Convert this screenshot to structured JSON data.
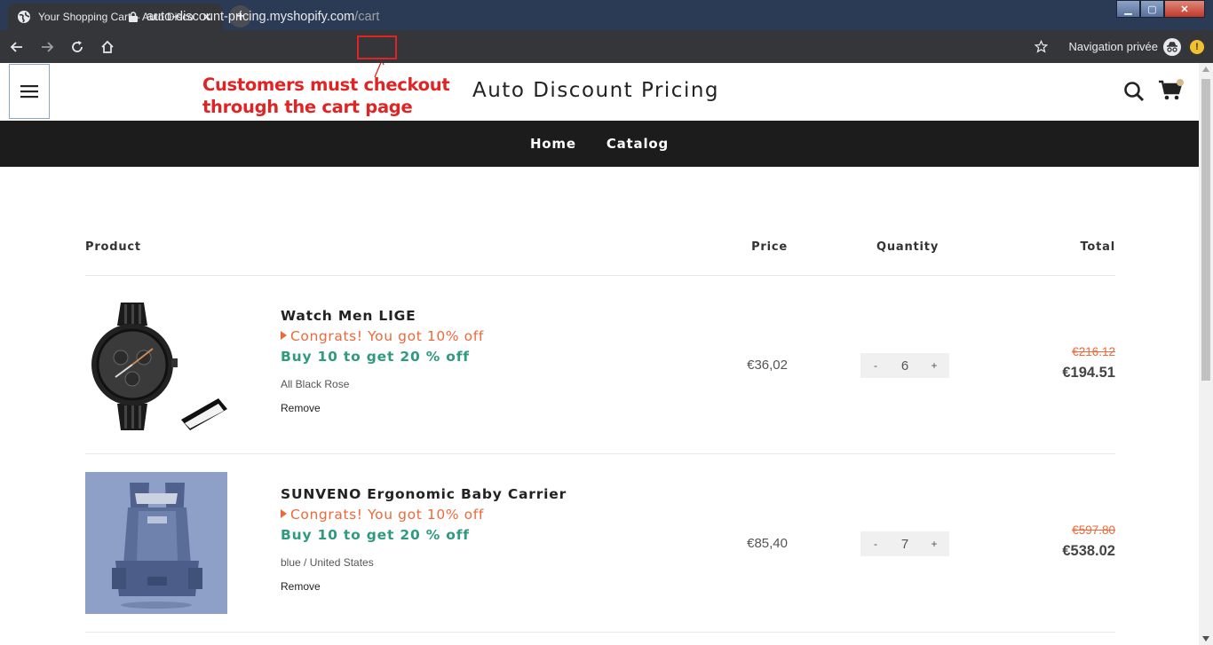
{
  "browser": {
    "tab_title": "Your Shopping Cart – Auto Disco",
    "url_host": "auto-discount-pricing.myshopify.com",
    "url_path": "/cart",
    "private_label": "Navigation privée",
    "ext_badge": "!"
  },
  "annotation": {
    "line1": "Customers must checkout",
    "line2": "through the cart page",
    "color": "#e02424"
  },
  "store": {
    "name": "Auto Discount Pricing"
  },
  "nav": {
    "items": [
      "Home",
      "Catalog"
    ]
  },
  "cart": {
    "headers": {
      "product": "Product",
      "price": "Price",
      "quantity": "Quantity",
      "total": "Total"
    },
    "items": [
      {
        "name": "Watch Men LIGE",
        "congrats": "Congrats! You got 10% off",
        "offer": "Buy 10 to get 20 % off",
        "variant": "All Black Rose",
        "remove_label": "Remove",
        "price": "€36,02",
        "quantity": "6",
        "old_total": "€216.12",
        "new_total": "€194.51"
      },
      {
        "name": "SUNVENO Ergonomic Baby Carrier",
        "congrats": "Congrats! You got 10% off",
        "offer": "Buy 10 to get 20 % off",
        "variant": "blue / United States",
        "remove_label": "Remove",
        "price": "€85,40",
        "quantity": "7",
        "old_total": "€597.80",
        "new_total": "€538.02"
      }
    ],
    "qty_minus": "-",
    "qty_plus": "+"
  },
  "colors": {
    "congrats": "#ec6a3a",
    "offer": "#2e9a80",
    "nav_bg": "#1c1c1c"
  }
}
